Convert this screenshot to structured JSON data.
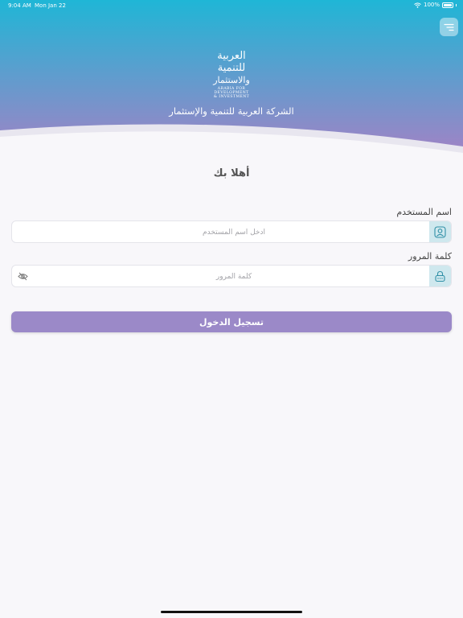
{
  "status_bar": {
    "time": "9:04 AM",
    "date": "Mon Jan 22",
    "battery": "100%"
  },
  "header": {
    "logo_arabic_lines": [
      "العربية",
      "للتنمية",
      "والاستثمار"
    ],
    "logo_english_lines": [
      "ARABIA FOR",
      "DEVELOPMENT",
      "& INVESTMENT"
    ],
    "company_name": "الشركة العربية للتنمية والإستثمار",
    "gradient_top": "#1fb6d6",
    "gradient_bottom": "#9b85c6"
  },
  "form": {
    "welcome": "أهلا بك",
    "username_label": "اسم المستخدم",
    "username_placeholder": "ادخل اسم المستخدم",
    "password_label": "كلمة المرور",
    "password_placeholder": "كلمة المرور",
    "login_label": "تسجيل الدخول"
  },
  "icons": {
    "menu": "menu-icon",
    "user": "user-icon",
    "lock": "lock-icon",
    "eye": "eye-slash-icon"
  },
  "colors": {
    "accent": "#9b89c8",
    "icon_bg": "#cfe8ee",
    "icon_stroke": "#2f8fa6"
  }
}
